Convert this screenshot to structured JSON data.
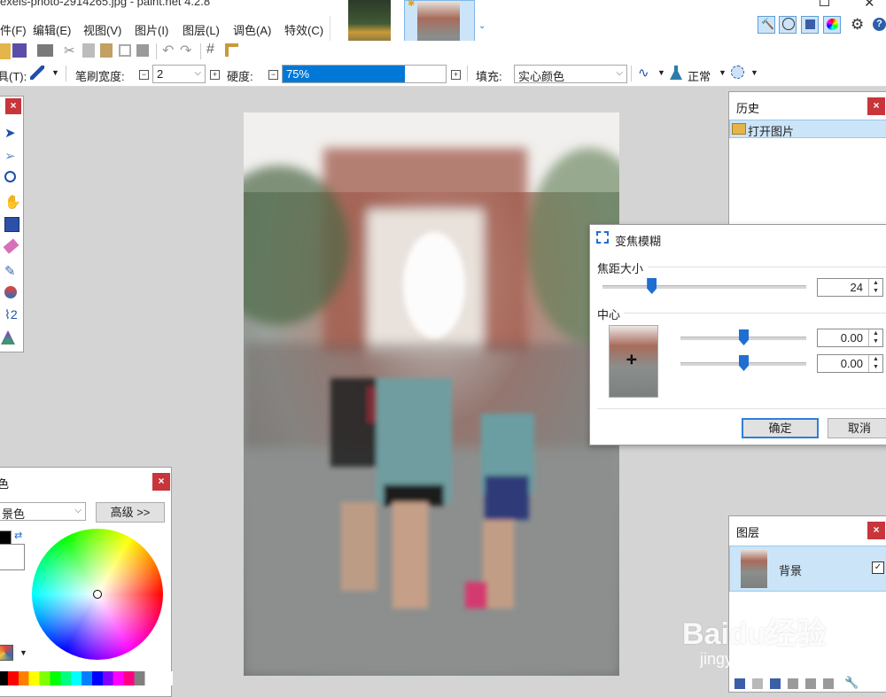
{
  "window": {
    "title": "exels-photo-2914265.jpg - paint.net 4.2.8"
  },
  "menu": {
    "items": [
      "件(F)",
      "编辑(E)",
      "视图(V)",
      "图片(I)",
      "图层(L)",
      "调色(A)",
      "特效(C)"
    ]
  },
  "toolbar": {
    "tool_label": "具(T):",
    "brush_width_label": "笔刷宽度:",
    "brush_width_value": "2",
    "hardness_label": "硬度:",
    "hardness_value": "75%",
    "hardness_fraction": 0.75,
    "fill_label": "填充:",
    "fill_value": "实心颜色",
    "blend_value": "正常"
  },
  "history_panel": {
    "title": "历史",
    "items": [
      "打开图片"
    ]
  },
  "layers_panel": {
    "title": "图层",
    "layers": [
      {
        "name": "背景",
        "visible": true
      }
    ]
  },
  "colors_panel": {
    "title": "色",
    "mode_value": "景色",
    "advanced_label": "高级 >>"
  },
  "zoom_blur_dialog": {
    "title": "变焦模糊",
    "amount_label": "焦距大小",
    "amount_value": "24",
    "amount_max": 100,
    "center_label": "中心",
    "center_x_value": "0.00",
    "center_y_value": "0.00",
    "ok_label": "确定",
    "cancel_label": "取消"
  },
  "watermark": {
    "logo": "Baidu经验",
    "url": "jingyan.baidu.com"
  },
  "colors": {
    "accent": "#0078d7",
    "selection_bg": "#cce4f7",
    "close_red": "#c8353a"
  }
}
